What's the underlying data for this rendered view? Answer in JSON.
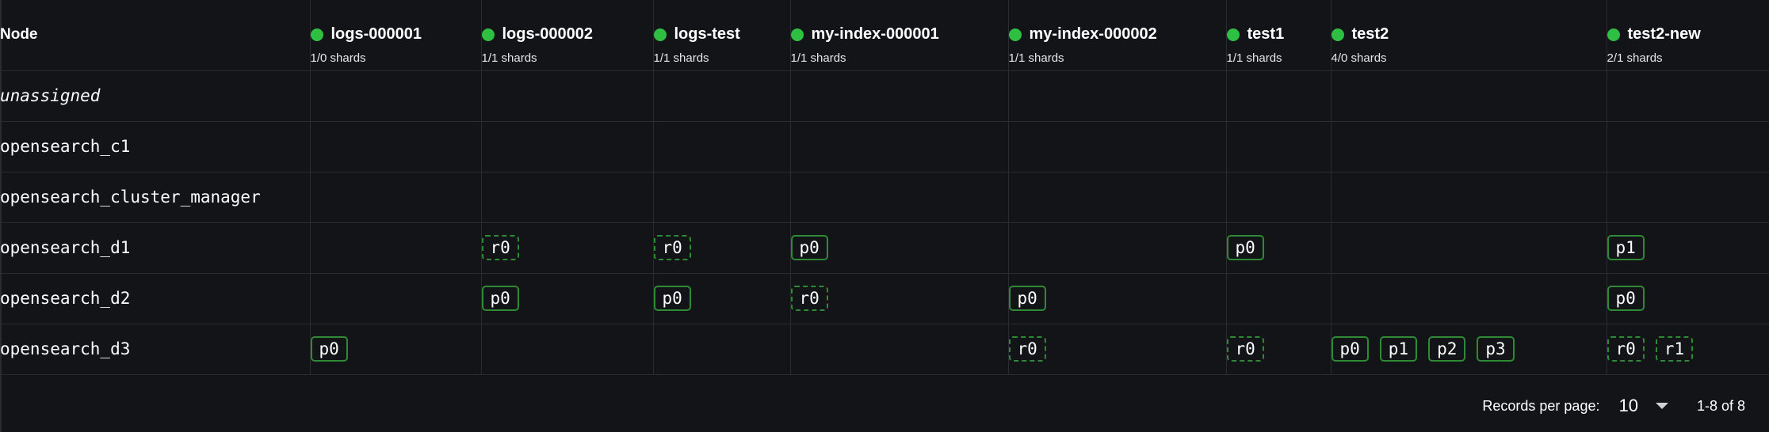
{
  "table": {
    "node_header": "Node",
    "indices": [
      {
        "name": "logs-000001",
        "shards": "1/0 shards"
      },
      {
        "name": "logs-000002",
        "shards": "1/1 shards"
      },
      {
        "name": "logs-test",
        "shards": "1/1 shards"
      },
      {
        "name": "my-index-000001",
        "shards": "1/1 shards"
      },
      {
        "name": "my-index-000002",
        "shards": "1/1 shards"
      },
      {
        "name": "test1",
        "shards": "1/1 shards"
      },
      {
        "name": "test2",
        "shards": "4/0 shards"
      },
      {
        "name": "test2-new",
        "shards": "2/1 shards"
      }
    ],
    "status_color": "#2fbf42",
    "rows": [
      {
        "node": "unassigned",
        "cells": [
          [],
          [],
          [],
          [],
          [],
          [],
          [],
          []
        ]
      },
      {
        "node": "opensearch_c1",
        "cells": [
          [],
          [],
          [],
          [],
          [],
          [],
          [],
          []
        ]
      },
      {
        "node": "opensearch_cluster_manager",
        "cells": [
          [],
          [],
          [],
          [],
          [],
          [],
          [],
          []
        ]
      },
      {
        "node": "opensearch_d1",
        "cells": [
          [],
          [
            "r0"
          ],
          [
            "r0"
          ],
          [
            "p0"
          ],
          [],
          [
            "p0"
          ],
          [],
          [
            "p1"
          ]
        ]
      },
      {
        "node": "opensearch_d2",
        "cells": [
          [],
          [
            "p0"
          ],
          [
            "p0"
          ],
          [
            "r0"
          ],
          [
            "p0"
          ],
          [],
          [],
          [
            "p0"
          ]
        ]
      },
      {
        "node": "opensearch_d3",
        "cells": [
          [
            "p0"
          ],
          [],
          [],
          [],
          [
            "r0"
          ],
          [
            "r0"
          ],
          [
            "p0",
            "p1",
            "p2",
            "p3"
          ],
          [
            "r0",
            "r1"
          ]
        ]
      }
    ]
  },
  "pagination": {
    "records_per_page_label": "Records per page:",
    "records_per_page_value": "10",
    "range_label": "1-8 of 8"
  }
}
